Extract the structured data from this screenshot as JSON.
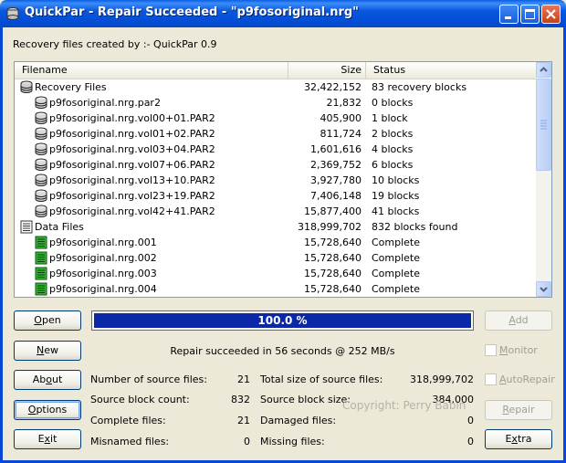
{
  "window": {
    "title": "QuickPar - Repair Succeeded - \"p9fosoriginal.nrg\""
  },
  "created_by": "Recovery files created by :- QuickPar 0.9",
  "list": {
    "headers": {
      "filename": "Filename",
      "size": "Size",
      "status": "Status"
    },
    "rows": [
      {
        "name": "Recovery Files",
        "size": "32,422,152",
        "status": "83 recovery blocks",
        "icon": "recovery-group-icon"
      },
      {
        "name": "p9fosoriginal.nrg.par2",
        "size": "21,832",
        "status": "0 blocks",
        "icon": "par2-file-icon"
      },
      {
        "name": "p9fosoriginal.nrg.vol00+01.PAR2",
        "size": "405,900",
        "status": "1 block",
        "icon": "par2-file-icon"
      },
      {
        "name": "p9fosoriginal.nrg.vol01+02.PAR2",
        "size": "811,724",
        "status": "2 blocks",
        "icon": "par2-file-icon"
      },
      {
        "name": "p9fosoriginal.nrg.vol03+04.PAR2",
        "size": "1,601,616",
        "status": "4 blocks",
        "icon": "par2-file-icon"
      },
      {
        "name": "p9fosoriginal.nrg.vol07+06.PAR2",
        "size": "2,369,752",
        "status": "6 blocks",
        "icon": "par2-file-icon"
      },
      {
        "name": "p9fosoriginal.nrg.vol13+10.PAR2",
        "size": "3,927,780",
        "status": "10 blocks",
        "icon": "par2-file-icon"
      },
      {
        "name": "p9fosoriginal.nrg.vol23+19.PAR2",
        "size": "7,406,148",
        "status": "19 blocks",
        "icon": "par2-file-icon"
      },
      {
        "name": "p9fosoriginal.nrg.vol42+41.PAR2",
        "size": "15,877,400",
        "status": "41 blocks",
        "icon": "par2-file-icon"
      },
      {
        "name": "Data Files",
        "size": "318,999,702",
        "status": "832 blocks found",
        "icon": "data-group-icon"
      },
      {
        "name": "p9fosoriginal.nrg.001",
        "size": "15,728,640",
        "status": "Complete",
        "icon": "complete-file-icon"
      },
      {
        "name": "p9fosoriginal.nrg.002",
        "size": "15,728,640",
        "status": "Complete",
        "icon": "complete-file-icon"
      },
      {
        "name": "p9fosoriginal.nrg.003",
        "size": "15,728,640",
        "status": "Complete",
        "icon": "complete-file-icon"
      },
      {
        "name": "p9fosoriginal.nrg.004",
        "size": "15,728,640",
        "status": "Complete",
        "icon": "complete-file-icon"
      }
    ]
  },
  "buttons": {
    "open": {
      "mnemonic": "O",
      "rest": "pen"
    },
    "new": {
      "mnemonic": "N",
      "rest": "ew"
    },
    "about": {
      "pre": "Ab",
      "mnemonic": "o",
      "rest": "ut"
    },
    "options": {
      "mnemonic": "O",
      "rest": "ptions"
    },
    "exit": {
      "pre": "E",
      "mnemonic": "x",
      "rest": "it"
    },
    "add": {
      "mnemonic": "A",
      "rest": "dd"
    },
    "repair": {
      "mnemonic": "R",
      "rest": "epair"
    },
    "extra": {
      "pre": "E",
      "mnemonic": "x",
      "rest": "tra"
    }
  },
  "progress": {
    "label": "100.0 %",
    "fraction": 1.0
  },
  "result": "Repair succeeded in 56 seconds @ 252 MB/s",
  "checkboxes": {
    "monitor": {
      "mnemonic": "M",
      "rest": "onitor",
      "checked": false
    },
    "autorepair": {
      "mnemonic": "A",
      "rest": "utoRepair",
      "checked": false
    }
  },
  "stats": {
    "source_files": {
      "label": "Number of source files:",
      "value": "21"
    },
    "block_count": {
      "label": "Source block count:",
      "value": "832"
    },
    "complete_files": {
      "label": "Complete files:",
      "value": "21"
    },
    "misnamed_files": {
      "label": "Misnamed files:",
      "value": "0"
    },
    "total_size": {
      "label": "Total size of source files:",
      "value": "318,999,702"
    },
    "block_size": {
      "label": "Source block size:",
      "value": "384,000"
    },
    "damaged_files": {
      "label": "Damaged files:",
      "value": "0"
    },
    "missing_files": {
      "label": "Missing files:",
      "value": "0"
    }
  },
  "watermark": "Copyright: Perry Babin"
}
